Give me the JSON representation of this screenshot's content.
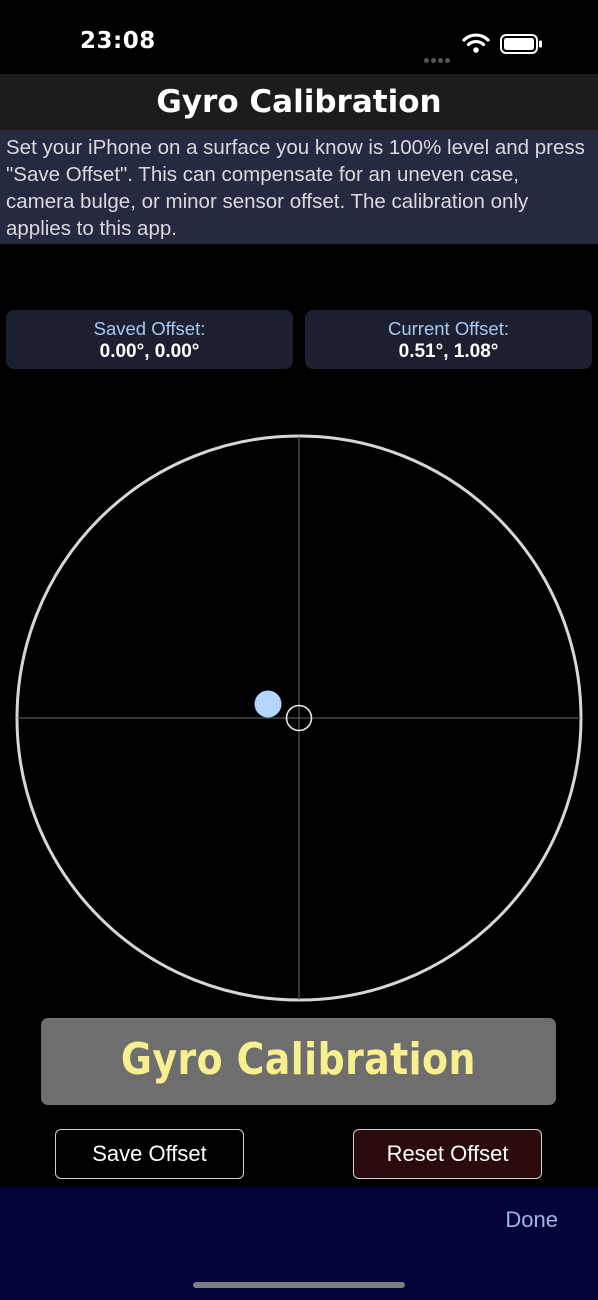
{
  "status_bar": {
    "time": "23:08",
    "wifi_icon": "wifi-icon",
    "battery_icon": "battery-icon"
  },
  "nav": {
    "title": "Gyro Calibration"
  },
  "instructions": {
    "text": "Set your iPhone on a surface you know is 100% level and press \"Save Offset\". This can compensate for an uneven case, camera bulge, or minor sensor offset. The calibration only applies to this app."
  },
  "offsets": {
    "saved": {
      "label": "Saved Offset:",
      "value": "0.00°, 0.00°"
    },
    "current": {
      "label": "Current Offset:",
      "value": "0.51°, 1.08°"
    }
  },
  "gauge": {
    "bubble_color": "#b3d7ff",
    "ring_color": "#d6d6d6"
  },
  "banner": {
    "text": "Gyro Calibration",
    "text_color": "#f8f08f"
  },
  "buttons": {
    "save_label": "Save Offset",
    "reset_label": "Reset Offset"
  },
  "footer": {
    "done_label": "Done"
  },
  "colors": {
    "accent": "#9fb4ee",
    "instructions_bg": "#262a40",
    "footer_bg": "#03033a"
  }
}
